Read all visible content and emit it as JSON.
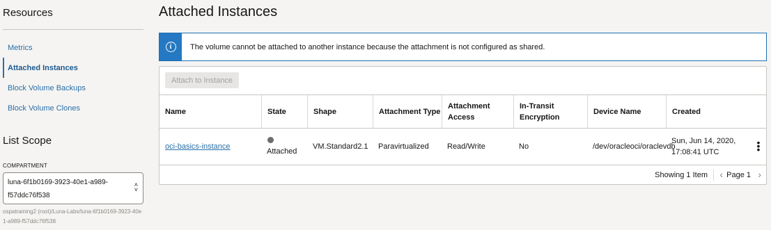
{
  "sidebar": {
    "resources_heading": "Resources",
    "nav": [
      {
        "label": "Metrics",
        "active": false
      },
      {
        "label": "Attached Instances",
        "active": true
      },
      {
        "label": "Block Volume Backups",
        "active": false
      },
      {
        "label": "Block Volume Clones",
        "active": false
      }
    ],
    "list_scope_heading": "List Scope",
    "compartment_label": "COMPARTMENT",
    "compartment_value": "luna-6f1b0169-3923-40e1-a989-f57ddc76f538",
    "compartment_path": "ospatraining2 (root)/Luna-Labs/luna-6f1b0169-3923-40e1-a989-f57ddc76f538"
  },
  "main": {
    "title": "Attached Instances",
    "info_icon": "i",
    "info_message": "The volume cannot be attached to another instance because the attachment is not configured as shared.",
    "attach_button": "Attach to Instance",
    "columns": [
      "Name",
      "State",
      "Shape",
      "Attachment Type",
      "Attachment Access",
      "In-Transit Encryption",
      "Device Name",
      "Created"
    ],
    "rows": [
      {
        "name": "oci-basics-instance",
        "state": "Attached",
        "shape": "VM.Standard2.1",
        "attachment_type": "Paravirtualized",
        "attachment_access": "Read/Write",
        "in_transit_encryption": "No",
        "device_name": "/dev/oracleoci/oraclevdb",
        "created": "Sun, Jun 14, 2020, 17:08:41 UTC"
      }
    ],
    "showing": "Showing 1 Item",
    "page_label": "Page 1"
  },
  "colors": {
    "accent": "#2a6fa8",
    "info_strip": "#2578c2",
    "state_dot": "#6f6c6a",
    "background": "#f5f4f2"
  },
  "icons": {
    "info": "info-icon",
    "select_arrows": "chevron-updown-icon",
    "row_actions": "kebab-icon",
    "prev": "chevron-left-icon",
    "next": "chevron-right-icon"
  }
}
